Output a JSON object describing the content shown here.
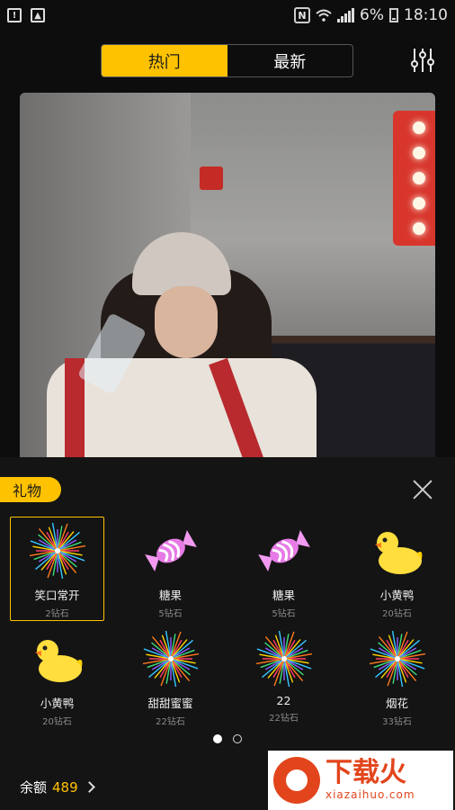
{
  "status_bar": {
    "battery": "6%",
    "time": "18:10",
    "nfc": "N"
  },
  "tabs": [
    {
      "label": "热门",
      "active": true
    },
    {
      "label": "最新",
      "active": false
    }
  ],
  "accent_color": "#ffc200",
  "gift_panel": {
    "title": "礼物",
    "gifts": [
      {
        "name": "笑口常开",
        "price": "2钻石",
        "icon": "fireworks-icon",
        "selected": true
      },
      {
        "name": "糖果",
        "price": "5钻石",
        "icon": "candy-icon"
      },
      {
        "name": "糖果",
        "price": "5钻石",
        "icon": "candy-icon"
      },
      {
        "name": "小黄鸭",
        "price": "20钻石",
        "icon": "duck-icon"
      },
      {
        "name": "小黄鸭",
        "price": "20钻石",
        "icon": "duck-icon"
      },
      {
        "name": "甜甜蜜蜜",
        "price": "22钻石",
        "icon": "fireworks-icon"
      },
      {
        "name": "22",
        "price": "22钻石",
        "icon": "fireworks-icon"
      },
      {
        "name": "烟花",
        "price": "33钻石",
        "icon": "fireworks-icon"
      }
    ],
    "pages": {
      "count": 2,
      "current": 1
    },
    "balance_label": "余额",
    "balance_value": "489"
  },
  "watermark": {
    "cn": "下载火",
    "en": "xiazaihuo.com"
  }
}
